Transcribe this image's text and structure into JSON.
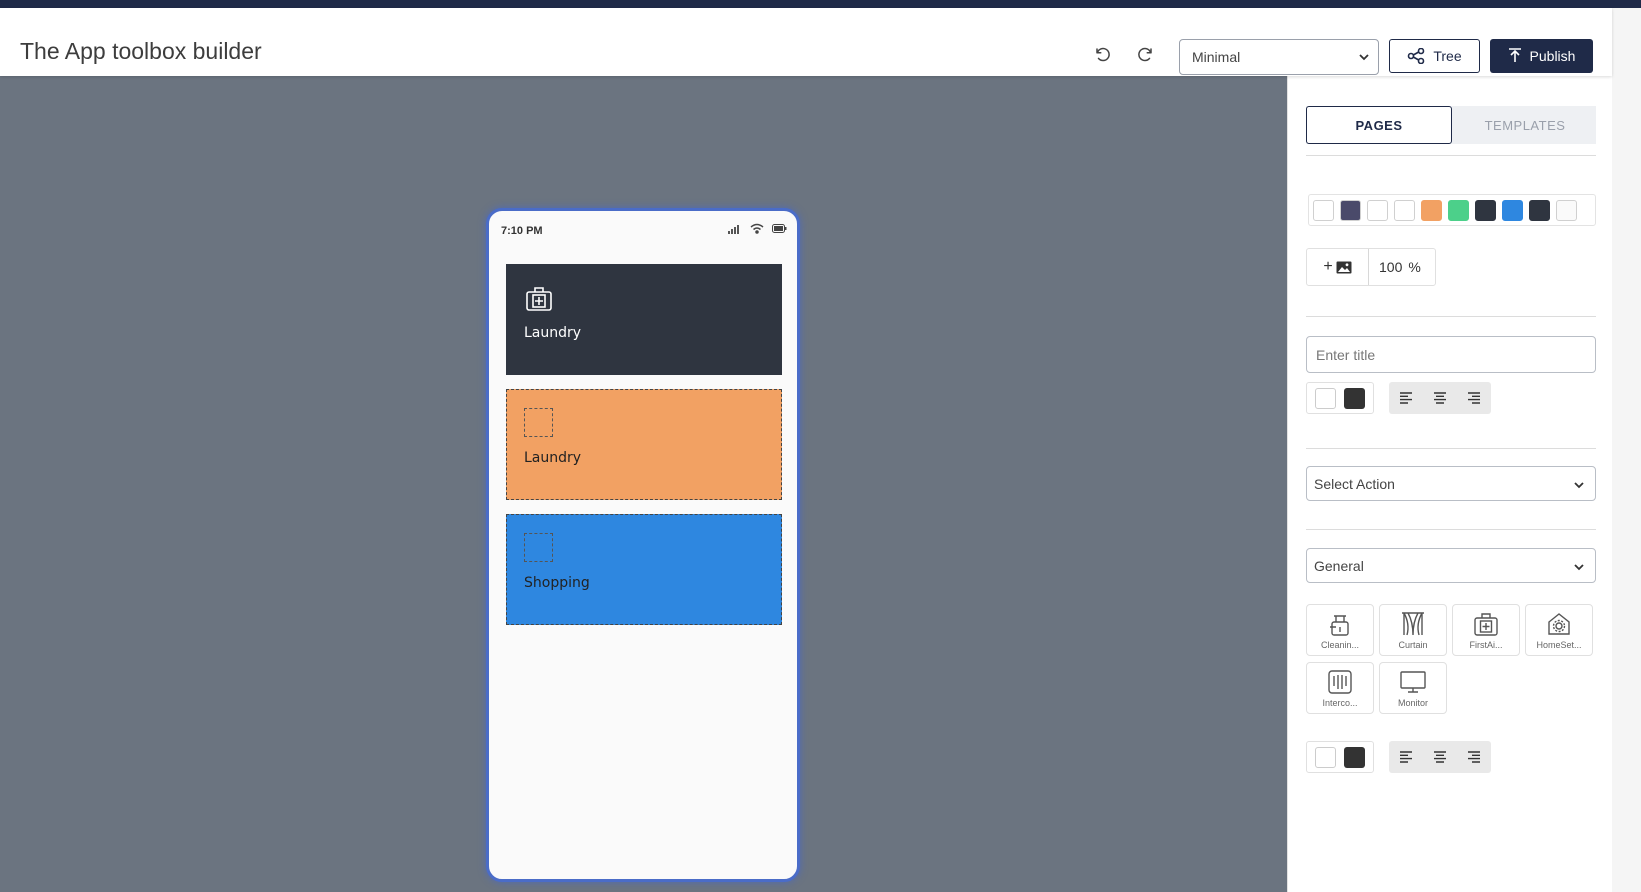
{
  "header": {
    "title": "The App toolbox builder",
    "theme_select": "Minimal",
    "tree_label": "Tree",
    "publish_label": "Publish"
  },
  "phone": {
    "status_time": "7:10 PM",
    "tiles": [
      {
        "label": "Laundry",
        "color": "#2f3540",
        "icon": "first-aid-kit-icon"
      },
      {
        "label": "Laundry",
        "color": "#f2a163",
        "icon": "placeholder"
      },
      {
        "label": "Shopping",
        "color": "#2e87e0",
        "icon": "placeholder"
      }
    ]
  },
  "sidebar": {
    "tabs": [
      "PAGES",
      "TEMPLATES"
    ],
    "active_tab": "PAGES",
    "swatches": [
      "#ffffff",
      "#4a4a6a",
      "#ffffff",
      "#ffffff",
      "#f2a163",
      "#4cd08a",
      "#2f3540",
      "#2e87e0",
      "#2f3540",
      "#fafafa"
    ],
    "image_zoom": "100",
    "zoom_unit": "%",
    "title_placeholder": "Enter title",
    "action_select": "Select Action",
    "category_select": "General",
    "icons": [
      {
        "label": "Cleanin...",
        "icon": "cleaning-icon"
      },
      {
        "label": "Curtain",
        "icon": "curtain-icon"
      },
      {
        "label": "FirstAi...",
        "icon": "first-aid-icon"
      },
      {
        "label": "HomeSet...",
        "icon": "home-settings-icon"
      },
      {
        "label": "Interco...",
        "icon": "intercom-icon"
      },
      {
        "label": "Monitor",
        "icon": "monitor-icon"
      }
    ]
  }
}
